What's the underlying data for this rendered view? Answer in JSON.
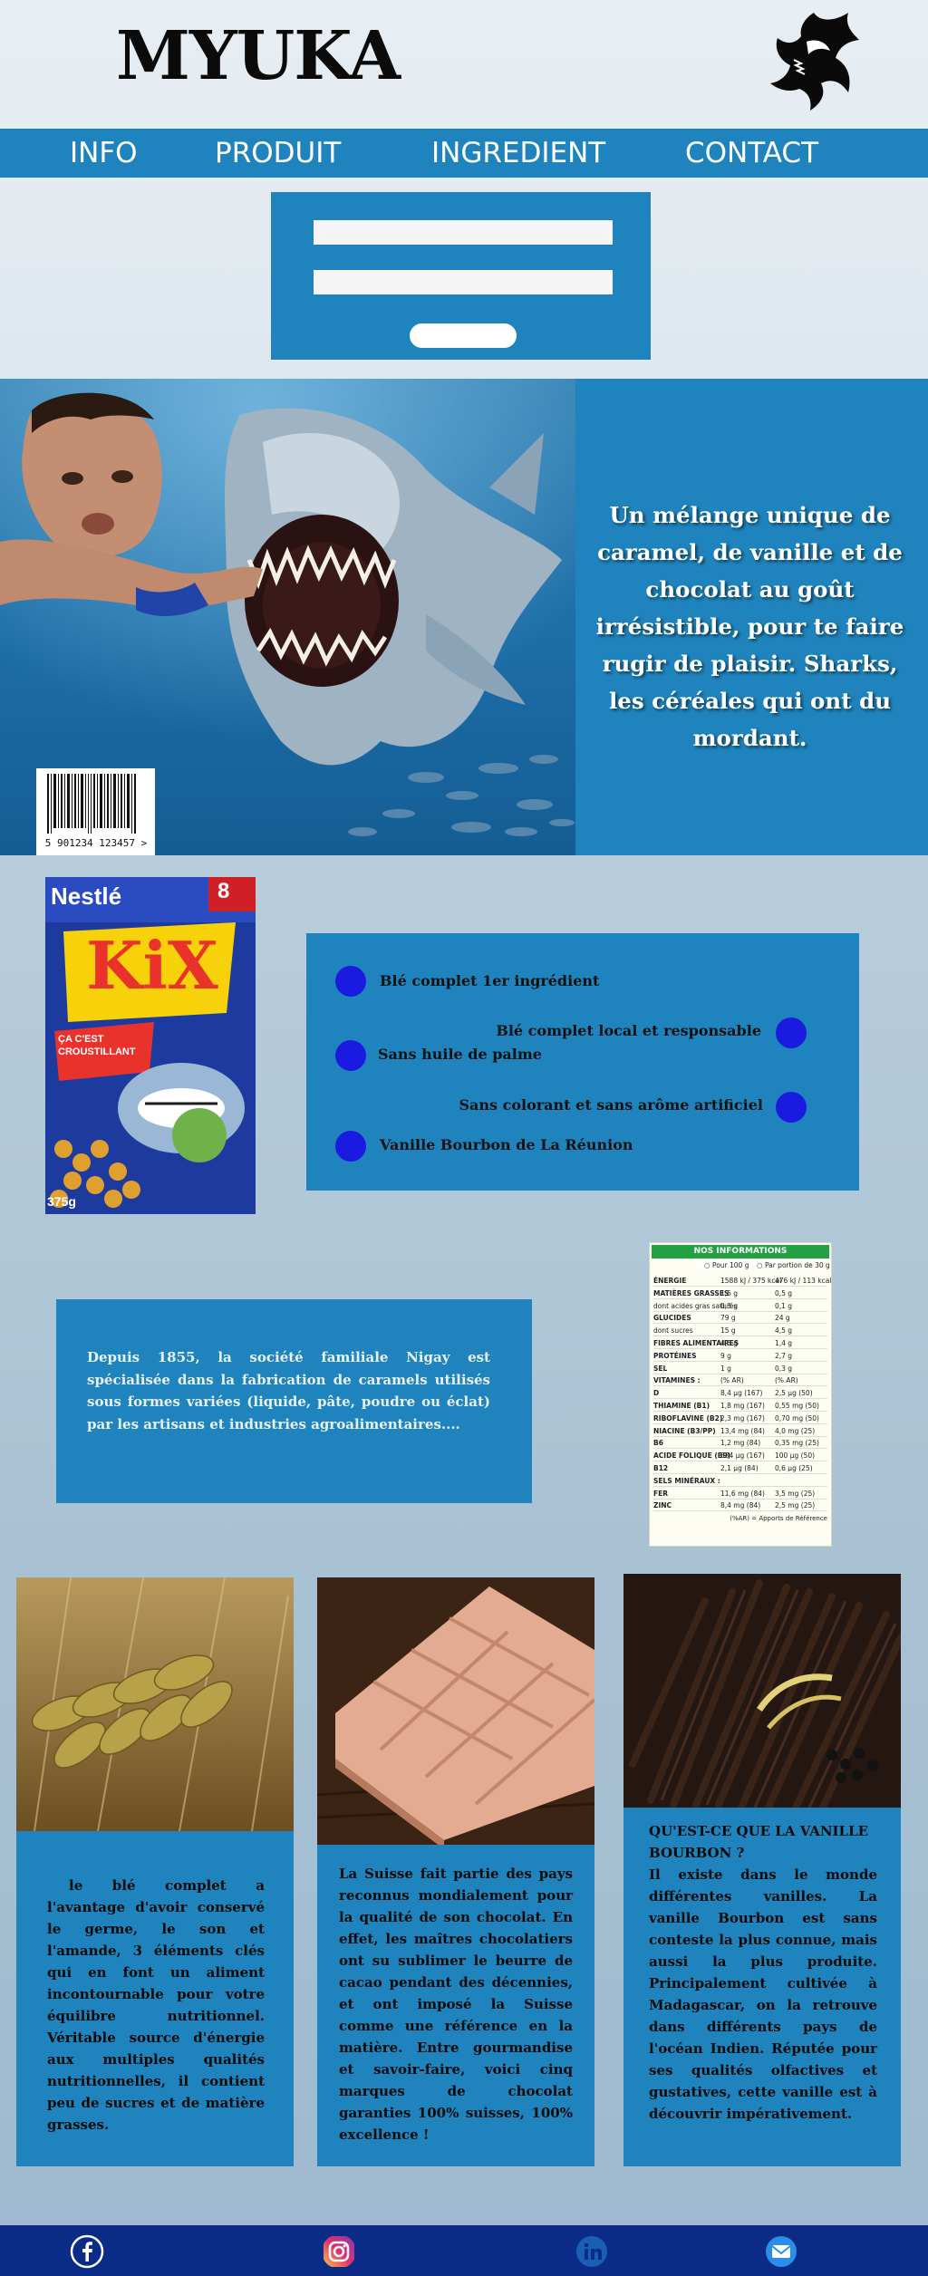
{
  "brand": {
    "name": "MYUKA",
    "logo_icon": "shark-logo-icon"
  },
  "nav": {
    "items": [
      "INFO",
      "PRODUIT",
      "INGREDIENT",
      "CONTACT"
    ]
  },
  "form": {
    "field1_value": "",
    "field2_value": "",
    "submit_label": ""
  },
  "hero": {
    "tagline": "Un mélange unique de caramel, de vanille et de chocolat au goût irrésistible, pour te faire rugir de plaisir. Sharks, les céréales qui ont du mordant.",
    "barcode_digits": "5 901234 123457 >"
  },
  "product": {
    "box_brand": "Nestlé",
    "box_name": "KiX",
    "box_badge": "8",
    "box_slogan": "ÇA C'EST CROUSTILLANT",
    "box_weight": "375g"
  },
  "features": [
    "Blé complet 1er ingrédient",
    "Blé complet local et responsable",
    "Sans huile de palme",
    "Sans colorant et sans arôme artificiel",
    "Vanille Bourbon de La Réunion"
  ],
  "history": {
    "text": "Depuis 1855, la société familiale Nigay est spécialisée dans la fabrication de caramels utilisés sous formes variées (liquide, pâte, poudre ou éclat) par les artisans et industries agroalimentaires...."
  },
  "nutrition": {
    "title": "NOS INFORMATIONS NUTRITIONNELLES",
    "col_100g": "Pour 100 g",
    "col_portion": "Par portion de 30 g",
    "rows": [
      [
        "ÉNERGIE",
        "1588 kJ / 375 kcal",
        "476 kJ / 113 kcal"
      ],
      [
        "MATIÈRES GRASSES",
        "1,5 g",
        "0,5 g"
      ],
      [
        "dont acides gras saturés",
        "0,3 g",
        "0,1 g"
      ],
      [
        "GLUCIDES",
        "79 g",
        "24 g"
      ],
      [
        "dont sucres",
        "15 g",
        "4,5 g"
      ],
      [
        "FIBRES ALIMENTAIRES",
        "4,5 g",
        "1,4 g"
      ],
      [
        "PROTÉINES",
        "9 g",
        "2,7 g"
      ],
      [
        "SEL",
        "1 g",
        "0,3 g"
      ],
      [
        "VITAMINES :",
        "(% AR)",
        "(% AR)"
      ],
      [
        "D",
        "8,4 µg (167)",
        "2,5 µg (50)"
      ],
      [
        "THIAMINE (B1)",
        "1,8 mg (167)",
        "0,55 mg (50)"
      ],
      [
        "RIBOFLAVINE (B2)",
        "2,3 mg (167)",
        "0,70 mg (50)"
      ],
      [
        "NIACINE (B3/PP)",
        "13,4 mg (84)",
        "4,0 mg (25)"
      ],
      [
        "B6",
        "1,2 mg (84)",
        "0,35 mg (25)"
      ],
      [
        "ACIDE FOLIQUE (B9)",
        "334 µg (167)",
        "100 µg (50)"
      ],
      [
        "B12",
        "2,1 µg (84)",
        "0,6 µg (25)"
      ],
      [
        "SELS MINÉRAUX :",
        "",
        ""
      ],
      [
        "FER",
        "11,6 mg (84)",
        "3,5 mg (25)"
      ],
      [
        "ZINC",
        "8,4 mg (84)",
        "2,5 mg (25)"
      ]
    ],
    "footnote": "(%AR) = Apports de Référence"
  },
  "cards": [
    {
      "name": "wheat",
      "text": "le blé complet a l'avantage d'avoir conservé le germe, le son et l'amande, 3 éléments clés qui en font un aliment incontournable pour votre équilibre nutritionnel. Véritable source d'énergie aux multiples qualités nutritionnelles, il contient peu de sucres et de matière grasses."
    },
    {
      "name": "chocolate",
      "text": "La Suisse fait partie des pays reconnus mondialement pour la qualité de son chocolat. En effet, les maîtres chocolatiers ont su sublimer le beurre de cacao pendant des décennies, et ont imposé la Suisse comme une référence en la matière. Entre gourmandise et savoir-faire, voici cinq marques de chocolat garanties 100% suisses, 100% excellence !"
    },
    {
      "name": "vanilla",
      "heading": "QU'EST-CE QUE LA VANILLE BOURBON ?",
      "text": "Il existe dans le monde différentes vanilles. La vanille Bourbon est sans conteste la plus connue, mais aussi la plus produite. Principalement cultivée à Madagascar, on la retrouve dans différents pays de l'océan Indien. Réputée pour ses qualités olfactives et gustatives, cette vanille est à découvrir impérativement."
    }
  ],
  "footer": {
    "icons": [
      "facebook-icon",
      "instagram-icon",
      "linkedin-icon",
      "mail-icon"
    ]
  },
  "colors": {
    "primary": "#1f84bd",
    "footer": "#0b2c86",
    "feature_dot": "#1a1ae0"
  }
}
